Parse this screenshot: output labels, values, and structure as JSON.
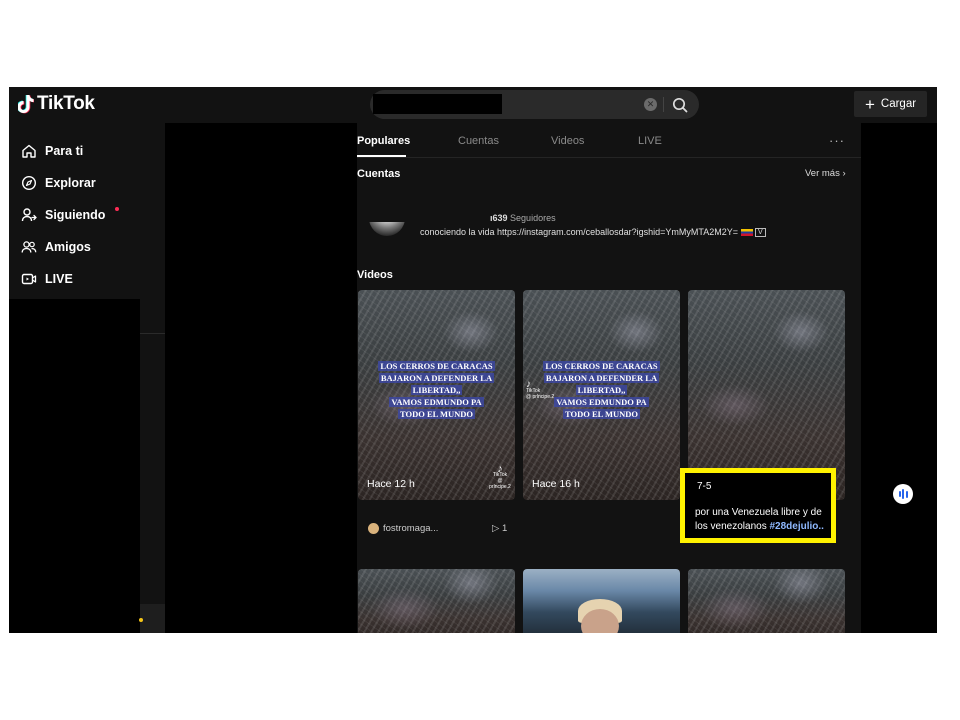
{
  "app": {
    "brand": "TikTok"
  },
  "search": {
    "query_redacted": "",
    "clear_icon": "clear-icon",
    "search_icon": "search-icon"
  },
  "header": {
    "upload_label": "Cargar",
    "upload_icon": "plus-icon"
  },
  "sidebar": {
    "items": [
      {
        "label": "Para ti",
        "icon": "home-icon"
      },
      {
        "label": "Explorar",
        "icon": "compass-icon"
      },
      {
        "label": "Siguiendo",
        "icon": "following-icon",
        "has_badge": true
      },
      {
        "label": "Amigos",
        "icon": "friends-icon"
      },
      {
        "label": "LIVE",
        "icon": "live-icon"
      }
    ]
  },
  "tabs": [
    {
      "label": "Populares",
      "active": true
    },
    {
      "label": "Cuentas",
      "active": false
    },
    {
      "label": "Videos",
      "active": false
    },
    {
      "label": "LIVE",
      "active": false
    }
  ],
  "tabs_more": "···",
  "accounts": {
    "title": "Cuentas",
    "see_more": "Ver más ›",
    "item": {
      "followers_count": "ı639",
      "followers_label": "Seguidores",
      "bio": "conociendo la vida https://instagram.com/ceballosdar?igshid=YmMyMTA2M2Y=",
      "verified_badge": "V"
    }
  },
  "videos": {
    "title": "Videos",
    "cards": [
      {
        "caption_lines": [
          "LOS CERROS DE CARACAS",
          "BAJARON A DEFENDER LA",
          "LIBERTAD,,",
          "VAMOS EDMUNDO PA",
          "TODO EL MUNDO"
        ],
        "time": "Hace 12 h",
        "watermark": "TikTok",
        "watermark_user": "@ prlncipe.2"
      },
      {
        "caption_lines": [
          "LOS CERROS DE CARACAS",
          "BAJARON A DEFENDER LA",
          "LIBERTAD,,",
          "VAMOS EDMUNDO PA",
          "TODO EL MUNDO"
        ],
        "time": "Hace 16 h",
        "watermark": "TikTok",
        "watermark_user": "@ prlncipe.2"
      },
      {
        "count": "7-5",
        "description": "por una Venezuela libre y de los venezolanos ",
        "hashtag": "#28dejulio.."
      }
    ],
    "meta_row": {
      "username": "fostromaga...",
      "plays": "▷ 1"
    }
  },
  "colors": {
    "highlight": "#fff200",
    "background": "#121212",
    "accent": "#fe2c55"
  }
}
